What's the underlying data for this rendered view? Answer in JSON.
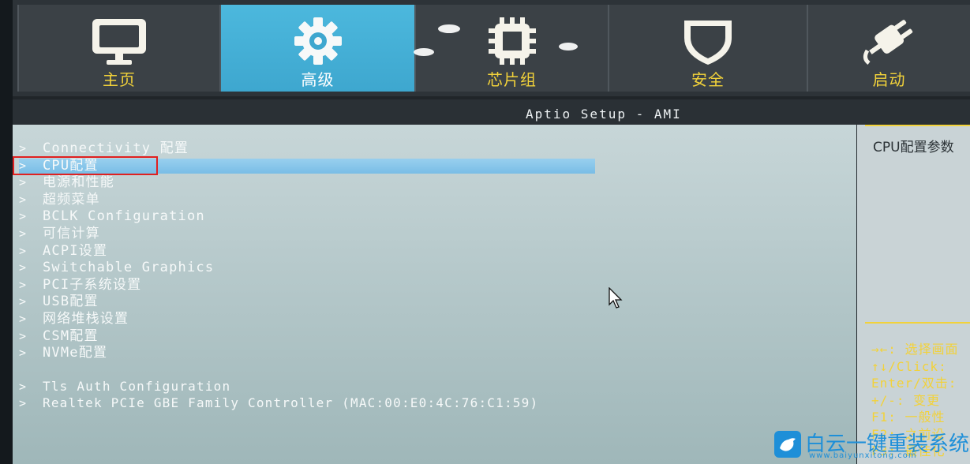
{
  "tabs": [
    {
      "label": "主页",
      "icon": "monitor-icon",
      "selected": false
    },
    {
      "label": "高级",
      "icon": "gear-icon",
      "selected": true
    },
    {
      "label": "芯片组",
      "icon": "chip-icon",
      "selected": false
    },
    {
      "label": "安全",
      "icon": "shield-icon",
      "selected": false
    },
    {
      "label": "启动",
      "icon": "plug-icon",
      "selected": false
    }
  ],
  "title": "Aptio Setup - AMI",
  "menu": {
    "items": [
      {
        "arrow": ">",
        "label": "Connectivity 配置"
      },
      {
        "arrow": ">",
        "label": "CPU配置"
      },
      {
        "arrow": ">",
        "label": "电源和性能"
      },
      {
        "arrow": ">",
        "label": "超频菜单"
      },
      {
        "arrow": ">",
        "label": "BCLK Configuration"
      },
      {
        "arrow": ">",
        "label": "可信计算"
      },
      {
        "arrow": ">",
        "label": "ACPI设置"
      },
      {
        "arrow": ">",
        "label": "Switchable Graphics"
      },
      {
        "arrow": ">",
        "label": "PCI子系统设置"
      },
      {
        "arrow": ">",
        "label": "USB配置"
      },
      {
        "arrow": ">",
        "label": "网络堆栈设置"
      },
      {
        "arrow": ">",
        "label": "CSM配置"
      },
      {
        "arrow": ">",
        "label": "NVMe配置"
      }
    ],
    "extra_items": [
      {
        "arrow": ">",
        "label": "Tls Auth Configuration"
      },
      {
        "arrow": ">",
        "label": "Realtek PCIe GBE Family Controller (MAC:00:E0:4C:76:C1:59)"
      }
    ],
    "selected_index": 1
  },
  "help": {
    "title": "CPU配置参数",
    "keys": [
      "→←: 选择画面",
      "↑↓/Click:",
      "Enter/双击:",
      "+/-: 变更",
      "F1: 一般性",
      "F2: 之前设",
      "F3: 最佳化"
    ]
  },
  "watermark": {
    "text": "白云一键重装系统",
    "url": "www.baiyunxitong.com",
    "icon": "bird-icon"
  },
  "colors": {
    "tab_selected": "#3ea7cf",
    "tab_label": "#f2d23a",
    "highlight": "#79bde6",
    "red_box": "#e02020",
    "watermark": "#1e8fd8"
  }
}
